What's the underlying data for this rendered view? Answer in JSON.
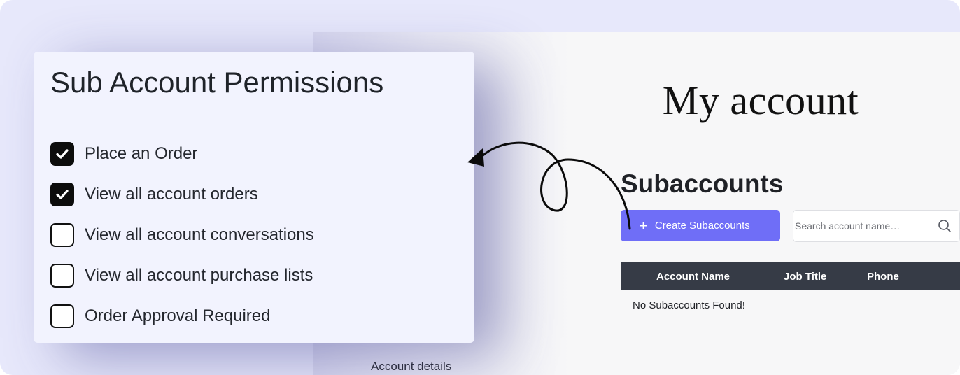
{
  "permissions": {
    "title": "Sub Account Permissions",
    "items": [
      {
        "label": "Place an Order",
        "checked": true
      },
      {
        "label": "View all account orders",
        "checked": true
      },
      {
        "label": "View all account conversations",
        "checked": false
      },
      {
        "label": "View all account purchase lists",
        "checked": false
      },
      {
        "label": "Order Approval Required",
        "checked": false
      }
    ]
  },
  "account": {
    "page_title": "My account",
    "section_title": "Subaccounts",
    "create_button_label": "Create Subaccounts",
    "search_placeholder": "Search account name…",
    "table": {
      "columns": [
        "Account Name",
        "Job Title",
        "Phone"
      ],
      "empty_message": "No Subaccounts Found!"
    },
    "footer_link": "Account details"
  },
  "colors": {
    "accent": "#6f6ef7",
    "table_header_bg": "#363b46",
    "canvas_bg": "#e7e8fb",
    "card_bg": "#f2f3fe"
  },
  "icons": {
    "create": "plus-icon",
    "search": "search-icon",
    "check": "checkmark-icon",
    "arrow": "curly-arrow-icon"
  }
}
